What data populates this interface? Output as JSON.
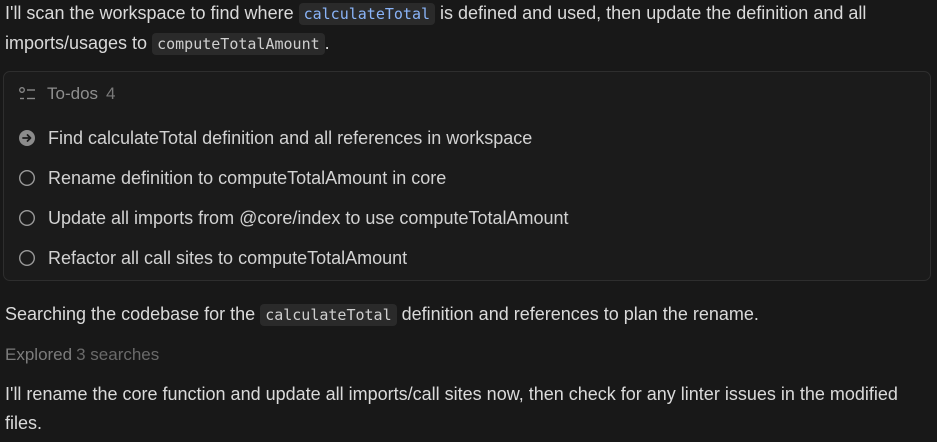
{
  "intro": {
    "part1": "I'll scan the workspace to find where ",
    "code1": "calculateTotal",
    "part2": " is defined and used, then update the definition and all imports/usages to ",
    "code2": "computeTotalAmount",
    "part3": "."
  },
  "todos": {
    "header_label": "To-dos",
    "count": "4",
    "items": [
      {
        "label": "Find calculateTotal definition and all references in workspace",
        "status": "in-progress"
      },
      {
        "label": "Rename definition to computeTotalAmount in core",
        "status": "pending"
      },
      {
        "label": "Update all imports from @core/index to use computeTotalAmount",
        "status": "pending"
      },
      {
        "label": "Refactor all call sites to computeTotalAmount",
        "status": "pending"
      }
    ]
  },
  "searching": {
    "part1": "Searching the codebase for the ",
    "code": "calculateTotal",
    "part2": " definition and references to plan the rename."
  },
  "explored": {
    "label": "Explored",
    "searches": "3 searches"
  },
  "closing": {
    "text": "I'll rename the core function and update all imports/call sites now, then check for any linter issues in the modified files."
  },
  "icons": {
    "list": "checklist-icon",
    "in_progress": "arrow-circle-icon",
    "pending": "empty-circle-icon"
  },
  "colors": {
    "background": "#181818",
    "code_accent": "#8ab4f8",
    "muted": "#7c7c7c"
  }
}
